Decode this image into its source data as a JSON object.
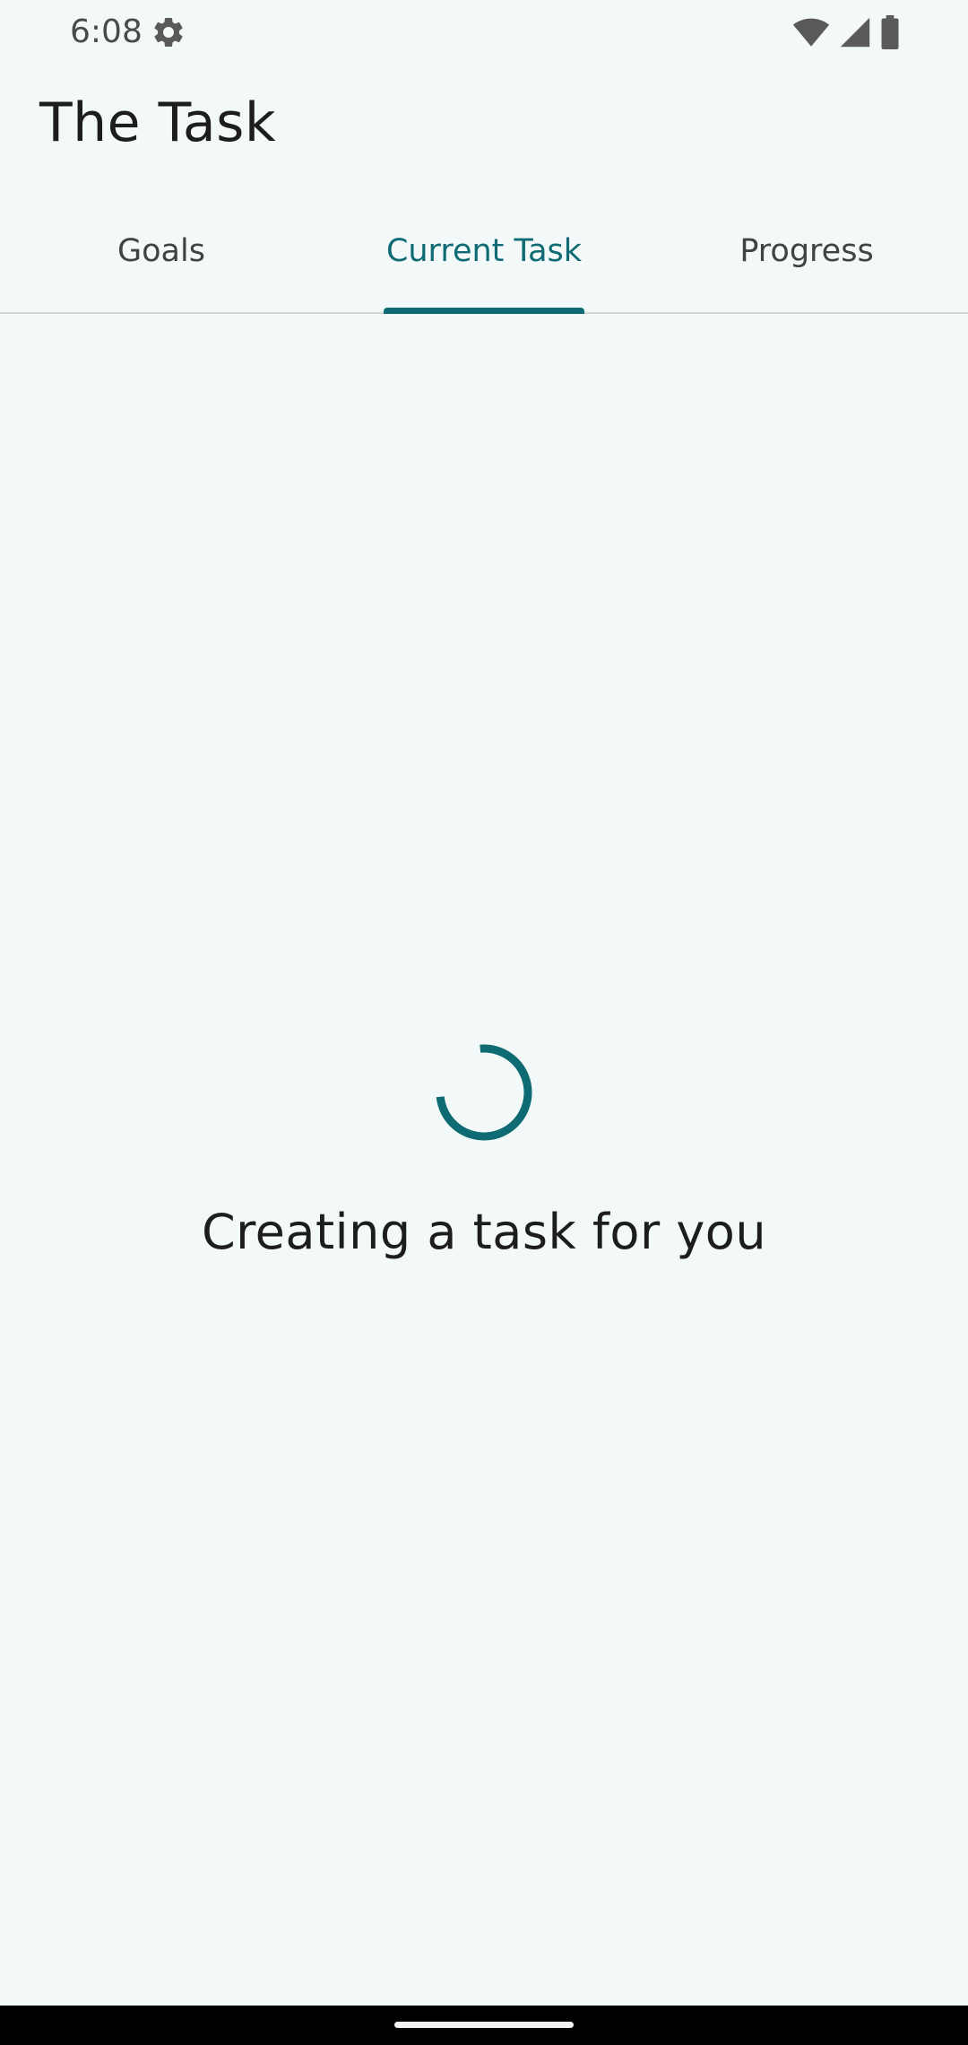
{
  "status_bar": {
    "time": "6:08",
    "icons": [
      "gear-icon",
      "wifi-icon",
      "cell-signal-icon",
      "battery-icon"
    ]
  },
  "app_bar": {
    "title": "The Task"
  },
  "tabs": [
    {
      "label": "Goals",
      "active": false
    },
    {
      "label": "Current Task",
      "active": true
    },
    {
      "label": "Progress",
      "active": false
    }
  ],
  "loading": {
    "message": "Creating a task for you"
  },
  "colors": {
    "accent": "#0e6b73",
    "background": "#f3f9f9",
    "text": "#1d1d1f"
  }
}
